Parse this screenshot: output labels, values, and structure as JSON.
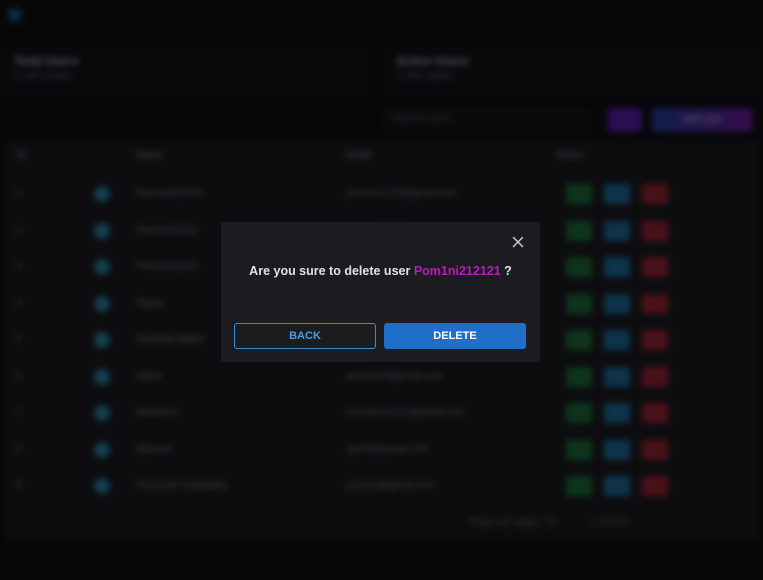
{
  "background": {
    "stats": [
      {
        "title": "Total Users",
        "value": "1 000 users"
      },
      {
        "title": "Active Users",
        "value": "1 000 users"
      }
    ],
    "search_placeholder": "Search users",
    "add_button_label": "Add user",
    "table": {
      "headers": [
        "ID",
        "Name",
        "Email",
        "Action"
      ],
      "rows": [
        {
          "id": "1",
          "name": "Pom1ni212121",
          "email": "pom1ni2121@gmail.com"
        },
        {
          "id": "2",
          "name": "Pom1ni21212",
          "email": "pom1ni212@gmail.com"
        },
        {
          "id": "3",
          "name": "Pom1ni21212",
          "email": "pom1ni2121@gmail.com"
        },
        {
          "id": "4",
          "name": "Pignol",
          "email": "pignol@gmail.com"
        },
        {
          "id": "5",
          "name": "Nicoletta Ballini",
          "email": "ballini@gmail.com"
        },
        {
          "id": "6",
          "name": "Adela",
          "email": "adela222@gmail.com"
        },
        {
          "id": "7",
          "name": "Marianne",
          "email": "marianne2121@gmail.com"
        },
        {
          "id": "8",
          "name": "Spencer",
          "email": "spen2@gmail.com"
        },
        {
          "id": "9",
          "name": "Pom1ni21 Kasandra",
          "email": "pom1ni@gmail.com"
        }
      ]
    },
    "pagination": {
      "rows_label": "Rows per page:",
      "rows_value": "10",
      "range": "1–9 of 9"
    }
  },
  "modal": {
    "message_prefix": "Are you sure to delete user",
    "username": "Pom1ni212121",
    "message_suffix": "?",
    "back_label": "BACK",
    "delete_label": "DELETE",
    "close_icon": "close-icon"
  },
  "colors": {
    "accent_blue": "#1f6fc9",
    "username_purple": "#b71dbd",
    "modal_bg": "#1b1c20"
  }
}
